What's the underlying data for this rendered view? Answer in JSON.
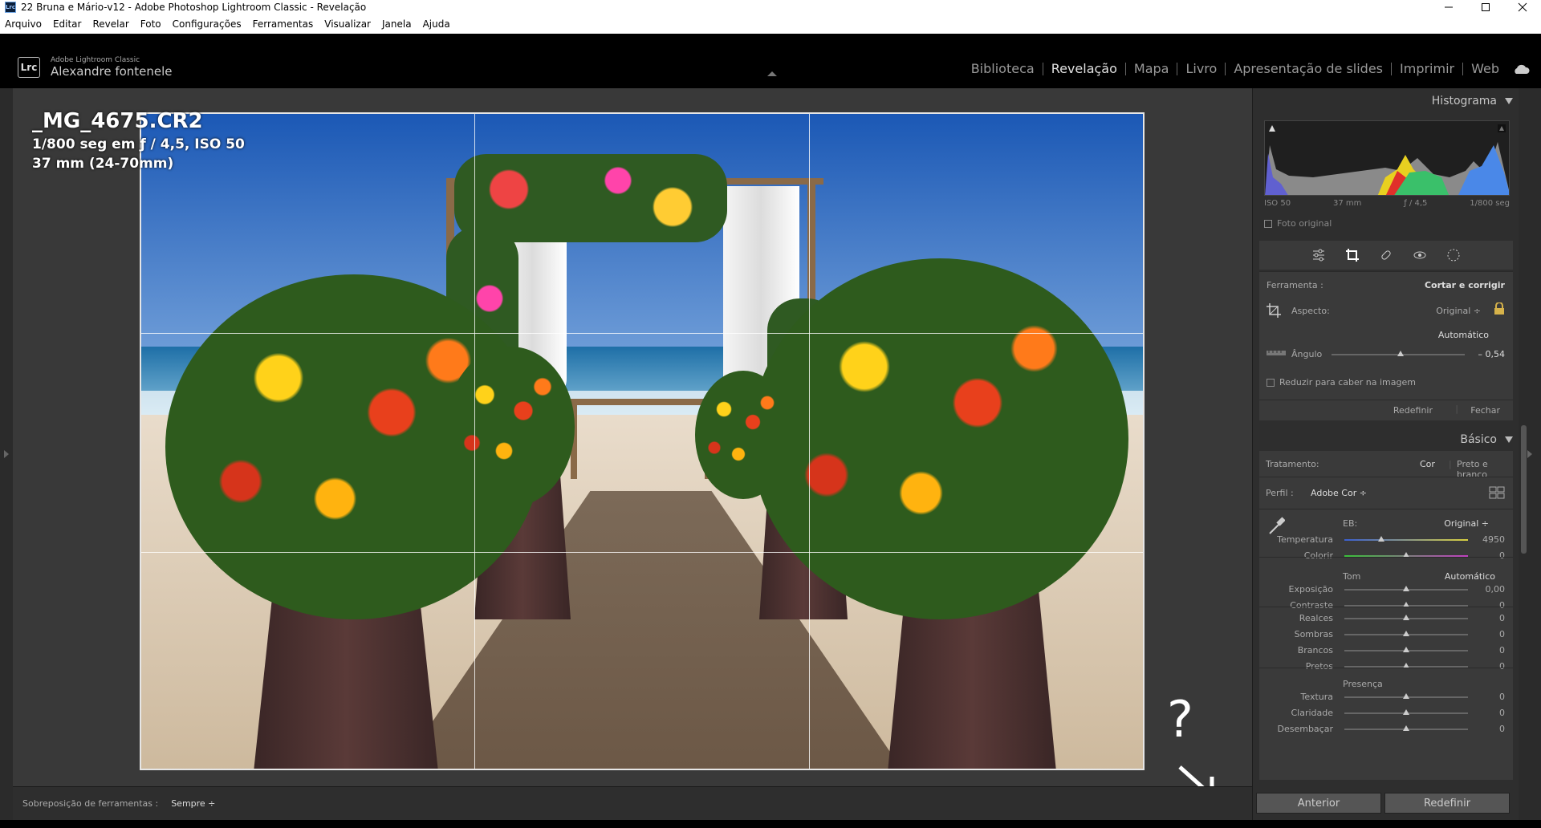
{
  "window": {
    "title": "22 Bruna e Mário-v12 - Adobe Photoshop Lightroom Classic - Revelação",
    "app_icon": "Lrc"
  },
  "menu": [
    "Arquivo",
    "Editar",
    "Revelar",
    "Foto",
    "Configurações",
    "Ferramentas",
    "Visualizar",
    "Janela",
    "Ajuda"
  ],
  "identity": {
    "logo": "Lrc",
    "product": "Adobe Lightroom Classic",
    "user": "Alexandre fontenele"
  },
  "modules": [
    "Biblioteca",
    "Revelação",
    "Mapa",
    "Livro",
    "Apresentação de slides",
    "Imprimir",
    "Web"
  ],
  "active_module": "Revelação",
  "photo": {
    "filename": "_MG_4675.CR2",
    "exposure_line": "1/800 seg em ƒ / 4,5, ISO 50",
    "lens_line": "37 mm (24-70mm)"
  },
  "overlay": {
    "question": "?"
  },
  "toolbar": {
    "label": "Sobreposição de ferramentas :",
    "value": "Sempre ÷"
  },
  "histogram": {
    "title": "Histograma",
    "iso": "ISO 50",
    "focal": "37 mm",
    "aperture": "ƒ / 4,5",
    "shutter": "1/800 seg",
    "original_label": "Foto original"
  },
  "crop": {
    "tool_label": "Ferramenta :",
    "tool_value": "Cortar e corrigir",
    "aspect_label": "Aspecto:",
    "aspect_value": "Original ÷",
    "auto_label": "Automático",
    "angle_label": "Ângulo",
    "angle_value": "– 0,54",
    "angle_fraction": 0.52,
    "constrain_label": "Reduzir para caber na imagem",
    "reset": "Redefinir",
    "close": "Fechar"
  },
  "basic": {
    "title": "Básico",
    "treatment_label": "Tratamento:",
    "treatment_color": "Cor",
    "treatment_bw": "Preto e branco",
    "profile_label": "Perfil :",
    "profile_value": "Adobe Cor ÷",
    "wb_label": "EB:",
    "wb_value": "Original ÷",
    "tone_label": "Tom",
    "tone_auto": "Automático",
    "presence_label": "Presença",
    "sliders_wb": [
      {
        "label": "Temperatura",
        "value": "4950",
        "fraction": 0.3
      },
      {
        "label": "Colorir",
        "value": "0",
        "fraction": 0.5
      }
    ],
    "sliders_tone1": [
      {
        "label": "Exposição",
        "value": "0,00",
        "fraction": 0.5
      },
      {
        "label": "Contraste",
        "value": "0",
        "fraction": 0.5
      }
    ],
    "sliders_tone2": [
      {
        "label": "Realces",
        "value": "0",
        "fraction": 0.5
      },
      {
        "label": "Sombras",
        "value": "0",
        "fraction": 0.5
      },
      {
        "label": "Brancos",
        "value": "0",
        "fraction": 0.5
      },
      {
        "label": "Pretos",
        "value": "0",
        "fraction": 0.5
      }
    ],
    "sliders_presence": [
      {
        "label": "Textura",
        "value": "0",
        "fraction": 0.5
      },
      {
        "label": "Claridade",
        "value": "0",
        "fraction": 0.5
      },
      {
        "label": "Desembaçar",
        "value": "0",
        "fraction": 0.5
      }
    ]
  },
  "buttons": {
    "previous": "Anterior",
    "reset": "Redefinir"
  },
  "colors": {
    "panel_bg": "#2e2e2e",
    "section_bg": "#3a3a3a",
    "canvas_bg": "#393939"
  }
}
